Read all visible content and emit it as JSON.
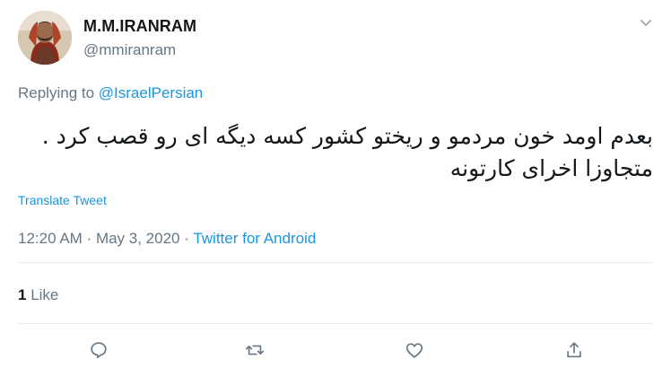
{
  "author": {
    "display_name": "M.M.IRANRAM",
    "handle": "@mmiranram",
    "avatar_icon": "user-avatar-photo"
  },
  "reply": {
    "prefix": "Replying to ",
    "mention": "@IsraelPersian"
  },
  "tweet": {
    "text": "بعدم اومد خون مردمو و ریختو کشور کسه دیگه ای رو قصب کرد . متجاوزا اخرای کارتونه"
  },
  "translate_label": "Translate Tweet",
  "meta": {
    "time": "12:20 AM",
    "separator": " · ",
    "date": "May 3, 2020",
    "source": "Twitter for Android"
  },
  "stats": {
    "likes_count": "1",
    "likes_label": " Like"
  },
  "actions": [
    "reply-icon",
    "retweet-icon",
    "like-icon",
    "share-icon"
  ],
  "colors": {
    "link": "#1b95e0",
    "secondary_text": "#657786",
    "primary_text": "#14171a",
    "divider": "#e6ecf0"
  }
}
